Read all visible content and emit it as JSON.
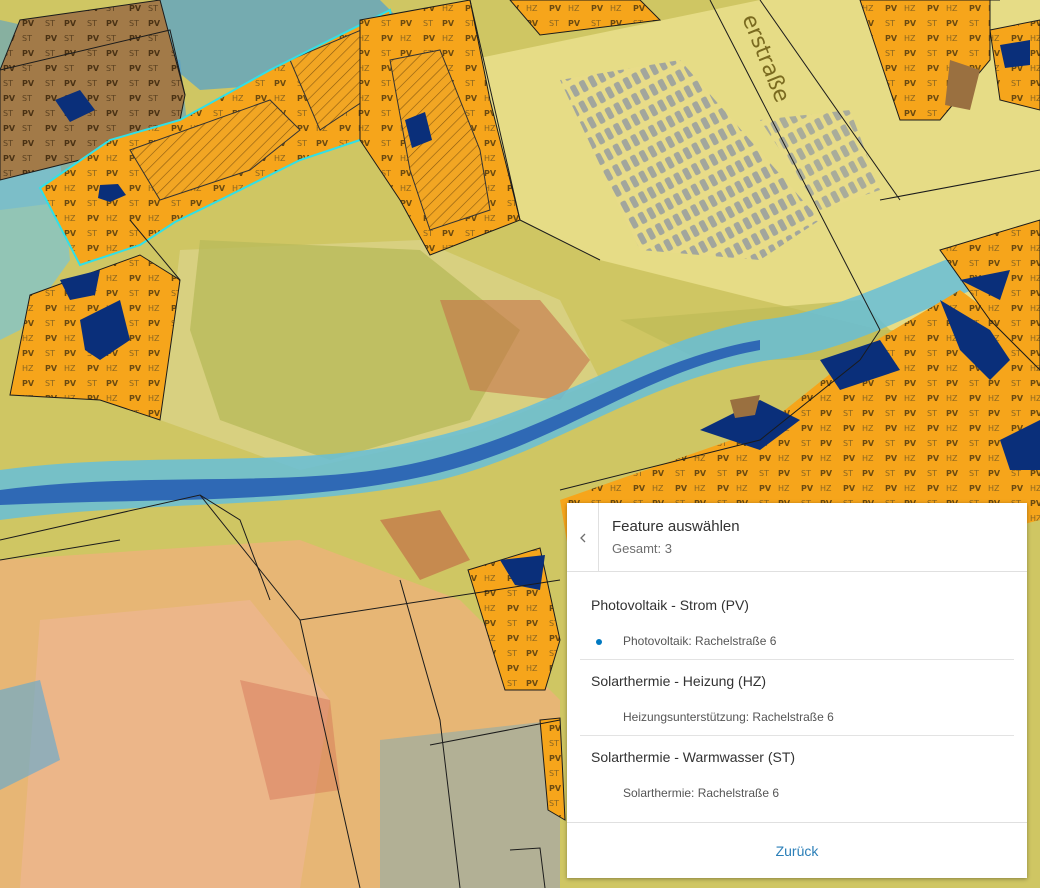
{
  "map": {
    "street_label": "erstraße",
    "roof_labels": [
      "PV",
      "ST",
      "HZ"
    ],
    "colors": {
      "roof_suitable": "#f6a51b",
      "roof_dark": "#0a2f7a",
      "roof_brown": "#9a7040",
      "selection_outline": "#30e0e8",
      "solar_low_blue": "#2f77c8",
      "solar_cyan": "#6ac3dc",
      "solar_yellow": "#e4d77e",
      "solar_orange": "#e8a84a",
      "solar_red": "#c86848",
      "parcel_line": "#1b1b1b"
    }
  },
  "popup": {
    "title": "Feature auswählen",
    "count": "Gesamt: 3",
    "back_icon": "chevron-left-icon",
    "groups": [
      {
        "title": "Photovoltaik - Strom (PV)",
        "item": "Photovoltaik: Rachelstraße 6",
        "selected": true
      },
      {
        "title": "Solarthermie - Heizung (HZ)",
        "item": "Heizungsunterstützung: Rachelstraße 6",
        "selected": false
      },
      {
        "title": "Solarthermie - Warmwasser (ST)",
        "item": "Solarthermie: Rachelstraße 6",
        "selected": false
      }
    ],
    "back_label": "Zurück",
    "accent": "#0079c1"
  }
}
